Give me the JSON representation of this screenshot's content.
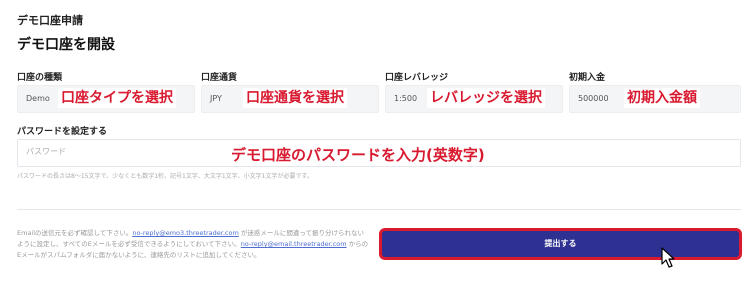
{
  "header": {
    "breadcrumb": "デモ口座申請",
    "title": "デモ口座を開設"
  },
  "fields": {
    "account_type": {
      "label": "口座の種類",
      "value": "Demo"
    },
    "currency": {
      "label": "口座通貨",
      "value": "JPY"
    },
    "leverage": {
      "label": "口座レバレッジ",
      "value": "1:500"
    },
    "deposit": {
      "label": "初期入金",
      "value": "500000"
    }
  },
  "password": {
    "label": "パスワードを設定する",
    "placeholder": "パスワード",
    "hint": "パスワードの長さは8〜15文字で、少なくとも数字1桁、記号1文字、大文字1文字、小文字1文字が必要です。"
  },
  "notice": {
    "text_1": "Emailの送信元を必ず確認して下さい。",
    "link_1": "no-reply@emo3.threetrader.com",
    "text_2": " が迷惑メールに間違って振り分けられないように設定し、すべてのEメールを必ず受信できるようにしておいて下さい。",
    "link_2": "no-reply@email.threetrader.com",
    "text_3": " からのEメールがスパムフォルダに届かないように、連絡先のリストに追加してください。"
  },
  "submit": {
    "label": "提出する"
  },
  "annotations": {
    "account_type": "口座タイプを選択",
    "currency": "口座通貨を選択",
    "leverage": "レバレッジを選択",
    "deposit": "初期入金額",
    "password": "デモ口座のパスワードを入力(英数字)"
  },
  "colors": {
    "submit_bg": "#2e3192",
    "highlight": "#d8192f",
    "link": "#4e6fd1"
  }
}
